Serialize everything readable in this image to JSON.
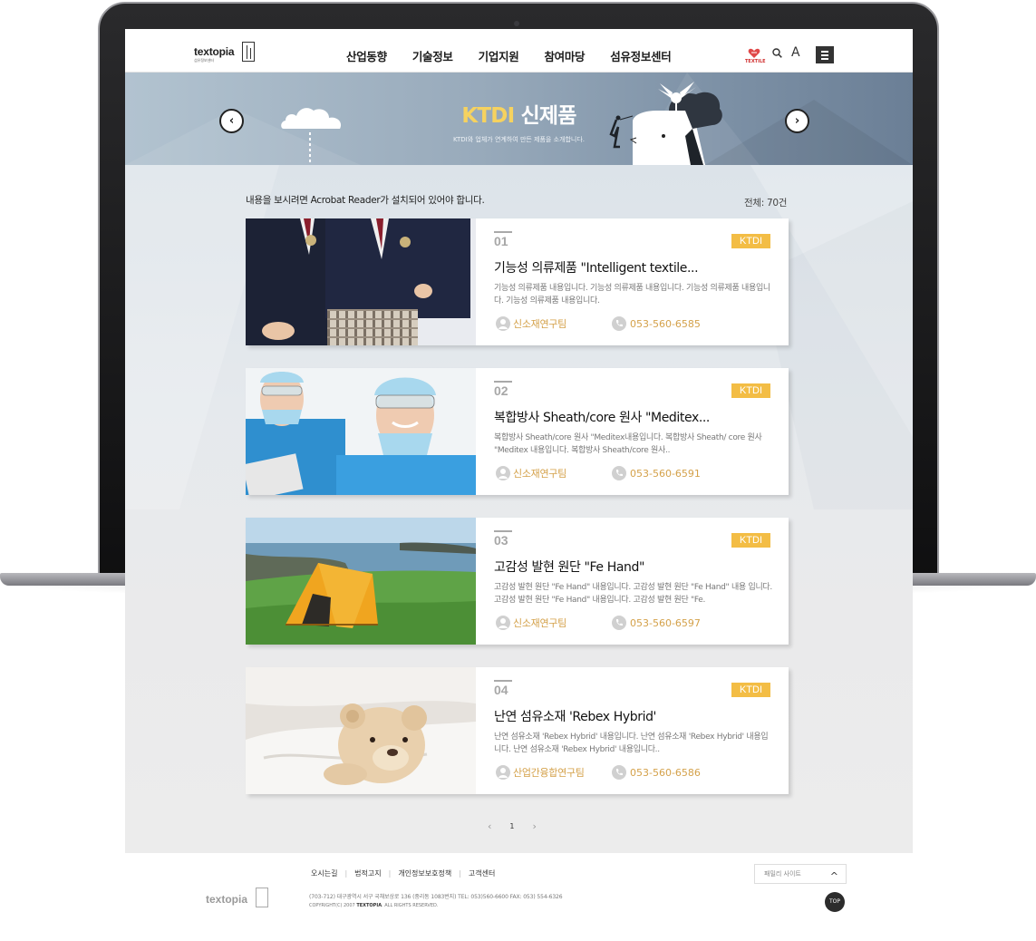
{
  "header": {
    "logo_text": "textopia",
    "logo_sub": "섬유정보센터",
    "nav": [
      "산업동향",
      "기술정보",
      "기업지원",
      "참여마당",
      "섬유정보센터"
    ],
    "textile_label": "TEXTILE",
    "font_label": "A"
  },
  "banner": {
    "title_hl": "KTDI",
    "title_rest": " 신제품",
    "subtitle": "KTDI와 업체가 연계하여 만든 제품을 소개합니다."
  },
  "content": {
    "notice": "내용을 보시려면 Acrobat Reader가 설치되어 있어야 합니다.",
    "total": "전체: 70건"
  },
  "cards": [
    {
      "num": "01",
      "badge": "KTDI",
      "title": "기능성 의류제품 \"Intelligent textile...",
      "desc": "기능성 의류제품 내용입니다. 기능성 의류제품 내용입니다. 기능성 의류제품 내용입니다. 기능성 의류제품 내용입니다.",
      "team": "신소재연구팀",
      "phone": "053-560-6585"
    },
    {
      "num": "02",
      "badge": "KTDI",
      "title": "복합방사 Sheath/core 원사 \"Meditex...",
      "desc": "복합방사 Sheath/core 원사 \"Meditex내용입니다. 복합방사 Sheath/ core 원사 \"Meditex 내용입니다. 복합방사 Sheath/core 원사..",
      "team": "신소재연구팀",
      "phone": "053-560-6591"
    },
    {
      "num": "03",
      "badge": "KTDI",
      "title": "고감성 발현 원단 \"Fe Hand\"",
      "desc": "고감성 발현 원단 \"Fe Hand\" 내용입니다. 고감성 발현 원단 \"Fe Hand\" 내용 입니다. 고감성 발현 원단 \"Fe Hand\" 내용입니다. 고감성 발현 원단 \"Fe.",
      "team": "신소재연구팀",
      "phone": "053-560-6597"
    },
    {
      "num": "04",
      "badge": "KTDI",
      "title": "난연 섬유소재 'Rebex Hybrid'",
      "desc": "난연 섬유소재 'Rebex Hybrid' 내용입니다. 난연 섬유소재 'Rebex Hybrid' 내용입니다. 난연 섬유소재 'Rebex Hybrid'  내용입니다..",
      "team": "산업간융합연구팀",
      "phone": "053-560-6586"
    }
  ],
  "pager": {
    "current": "1",
    "prev": "‹",
    "next": "›"
  },
  "footer": {
    "links": [
      "오시는길",
      "법적고지",
      "개인정보보호정책",
      "고객센터"
    ],
    "logo_text": "textopia",
    "address": "(703-712) 대구광역시 서구 국채보상로 136 (중리동 1083번지)    TEL: 053)560-6600    FAX: 053) 554-6326",
    "copyright_pre": "COPYRIGHT(C) 2007 ",
    "copyright_brand": "TEXTOPIA",
    "copyright_post": ". ALL RIGHTS RESERVED.",
    "family_site": "패밀리 사이트",
    "top": "TOP"
  },
  "colors": {
    "accent": "#f3bd45",
    "team_text": "#d4a14a",
    "banner_title": "#f6d25f"
  }
}
